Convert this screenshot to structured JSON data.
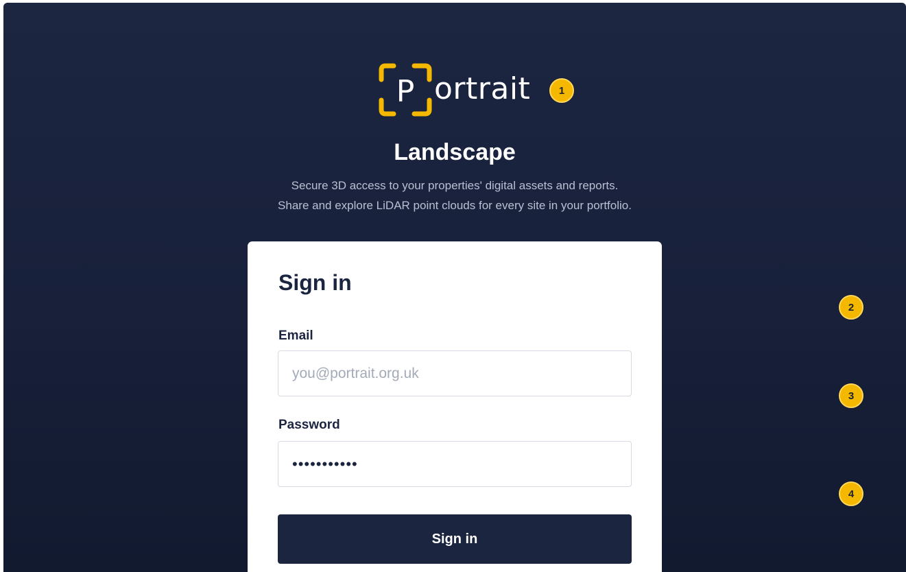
{
  "brand": {
    "logo_letter": "P",
    "logo_rest": "ortrait",
    "accent_color": "#f5b800"
  },
  "app": {
    "title": "Landscape",
    "tagline_line1": "Secure 3D access to your properties' digital assets and reports.",
    "tagline_line2": "Share and explore LiDAR point clouds for every site in your portfolio."
  },
  "signin": {
    "heading": "Sign in",
    "email_label": "Email",
    "email_placeholder": "you@portrait.org.uk",
    "email_value": "",
    "password_label": "Password",
    "password_value": "•••••••••••",
    "submit_label": "Sign in"
  },
  "annotations": [
    "1",
    "2",
    "3",
    "4"
  ],
  "colors": {
    "background": "#1c2641",
    "card": "#ffffff",
    "primary_text": "#1c2540",
    "badge": "#f5b800"
  }
}
